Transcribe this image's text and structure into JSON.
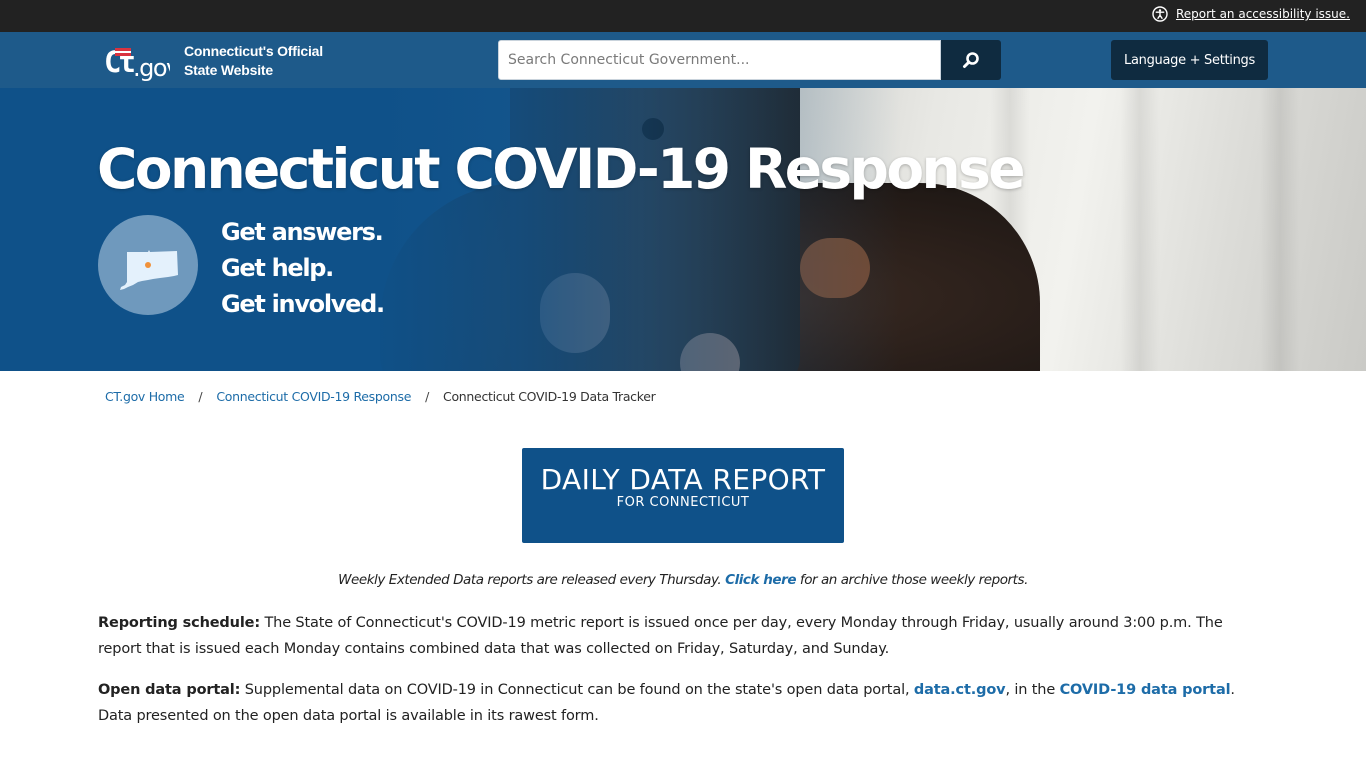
{
  "utility_bar": {
    "accessibility_link": "Report an accessibility issue."
  },
  "header": {
    "logo_text": "ct.gov",
    "site_title_line1": "Connecticut's Official",
    "site_title_line2": "State Website",
    "search": {
      "placeholder": "Search Connecticut Government...",
      "value": "",
      "button_icon": "search-icon"
    },
    "language_button": "Language + Settings"
  },
  "hero": {
    "title": "Connecticut COVID-19 Response",
    "badge_icon": "connecticut-map-icon",
    "taglines": [
      "Get answers.",
      "Get help.",
      "Get involved."
    ]
  },
  "breadcrumb": {
    "items": [
      {
        "label": "CT.gov Home",
        "link": true
      },
      {
        "label": "Connecticut COVID-19 Response",
        "link": true
      },
      {
        "label": "Connecticut COVID-19 Data Tracker",
        "link": false
      }
    ],
    "separator": "/"
  },
  "daily_report": {
    "title": "DAILY DATA REPORT",
    "subtitle": "FOR CONNECTICUT"
  },
  "weekly_note": {
    "before": "Weekly Extended Data reports are released every Thursday. ",
    "link": "Click here",
    "after": " for an archive those weekly reports."
  },
  "reporting_schedule": {
    "label": "Reporting schedule:",
    "text": " The State of Connecticut's COVID-19 metric report is issued once per day, every Monday through Friday, usually around 3:00 p.m. The report that is issued each Monday contains combined data that was collected on Friday, Saturday, and Sunday."
  },
  "open_data_portal": {
    "label": "Open data portal:",
    "text1": " Supplemental data on COVID-19 in Connecticut can be found on the state's open data portal, ",
    "link1": "data.ct.gov",
    "text2": ", in the ",
    "link2": "COVID-19 data portal",
    "text3": ". Data presented on the open data portal is available in its rawest form."
  },
  "colors": {
    "utility_bar": "#222222",
    "header": "#1e5a8a",
    "dark_button": "#0f2b40",
    "brand_blue": "#0f5189",
    "link": "#1d6ca8",
    "badge": "#6f99bd",
    "map_dot": "#f0913a"
  }
}
